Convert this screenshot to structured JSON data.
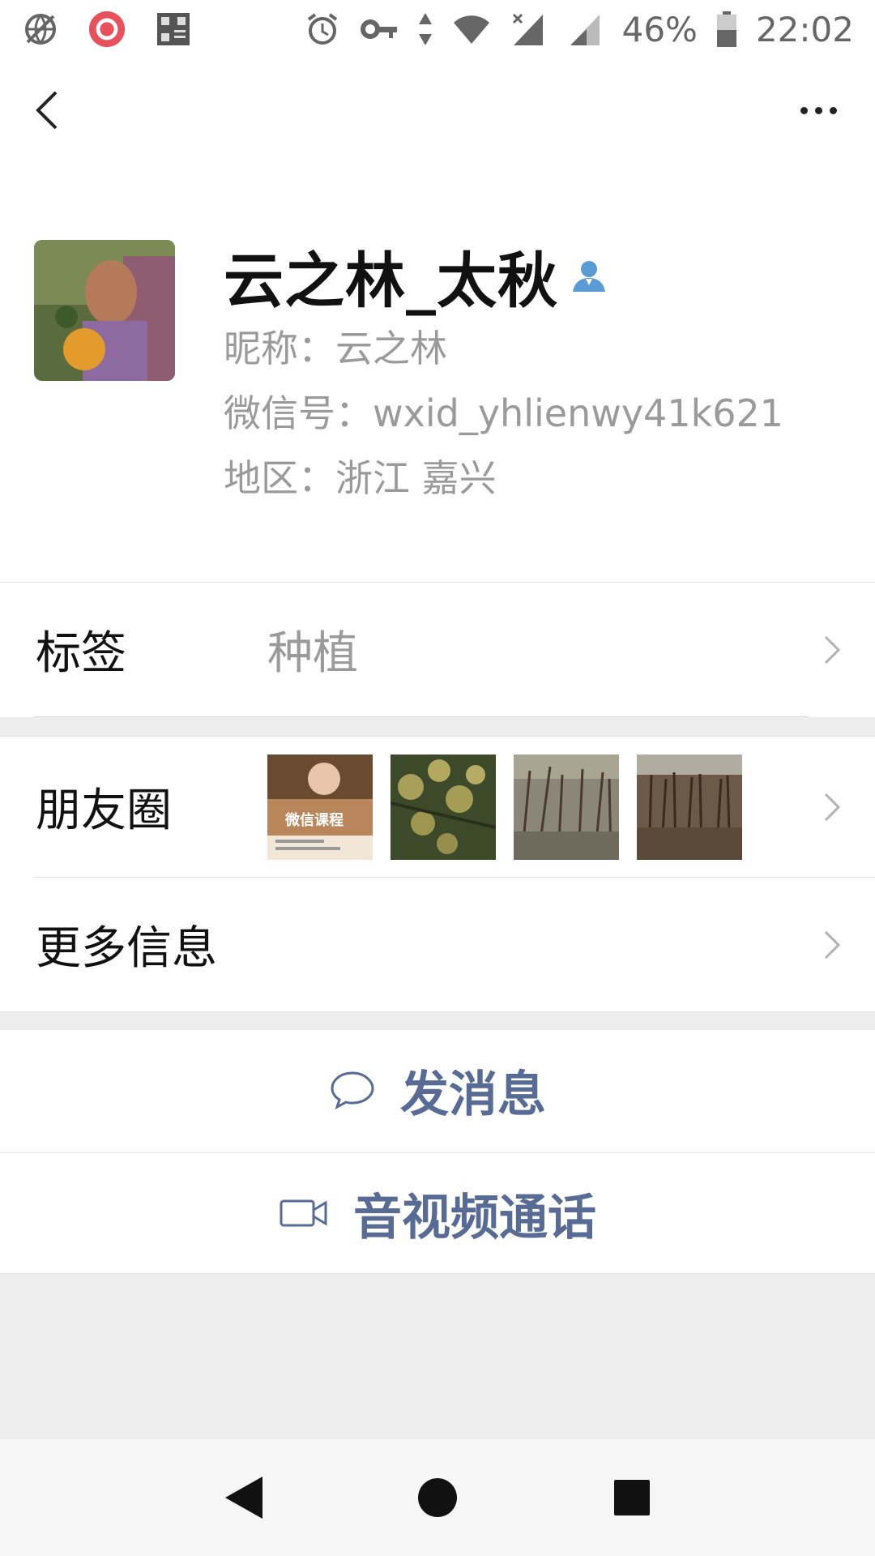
{
  "status_bar": {
    "battery_percent": "46%",
    "time": "22:02",
    "left_icons": [
      "globe-crossed-icon",
      "camera-record-icon",
      "app-grid-icon"
    ],
    "right_icons": [
      "alarm-icon",
      "vpn-key-icon",
      "data-arrows-icon",
      "wifi-icon",
      "signal-no-sim-icon",
      "signal-icon",
      "battery-icon"
    ]
  },
  "top_bar": {
    "back_icon": "chevron-left-icon",
    "more_icon": "more-dots-icon"
  },
  "profile": {
    "display_name": "云之林_太秋",
    "nickname_line": "昵称：云之林",
    "wechat_id_line": "微信号：wxid_yhlienwy41k621",
    "region_line": "地区：浙江  嘉兴"
  },
  "rows": {
    "tags_label": "标签",
    "tags_value": "种植",
    "moments_label": "朋友圈",
    "moments_thumb_text": "微信课程",
    "more_info_label": "更多信息"
  },
  "actions": {
    "send_message": "发消息",
    "video_call": "音视频通话"
  },
  "colors": {
    "link_blue": "#576b95",
    "verify_blue": "#5b9bd5",
    "gray_text": "#9a9a9a",
    "band_gray": "#ededed"
  }
}
